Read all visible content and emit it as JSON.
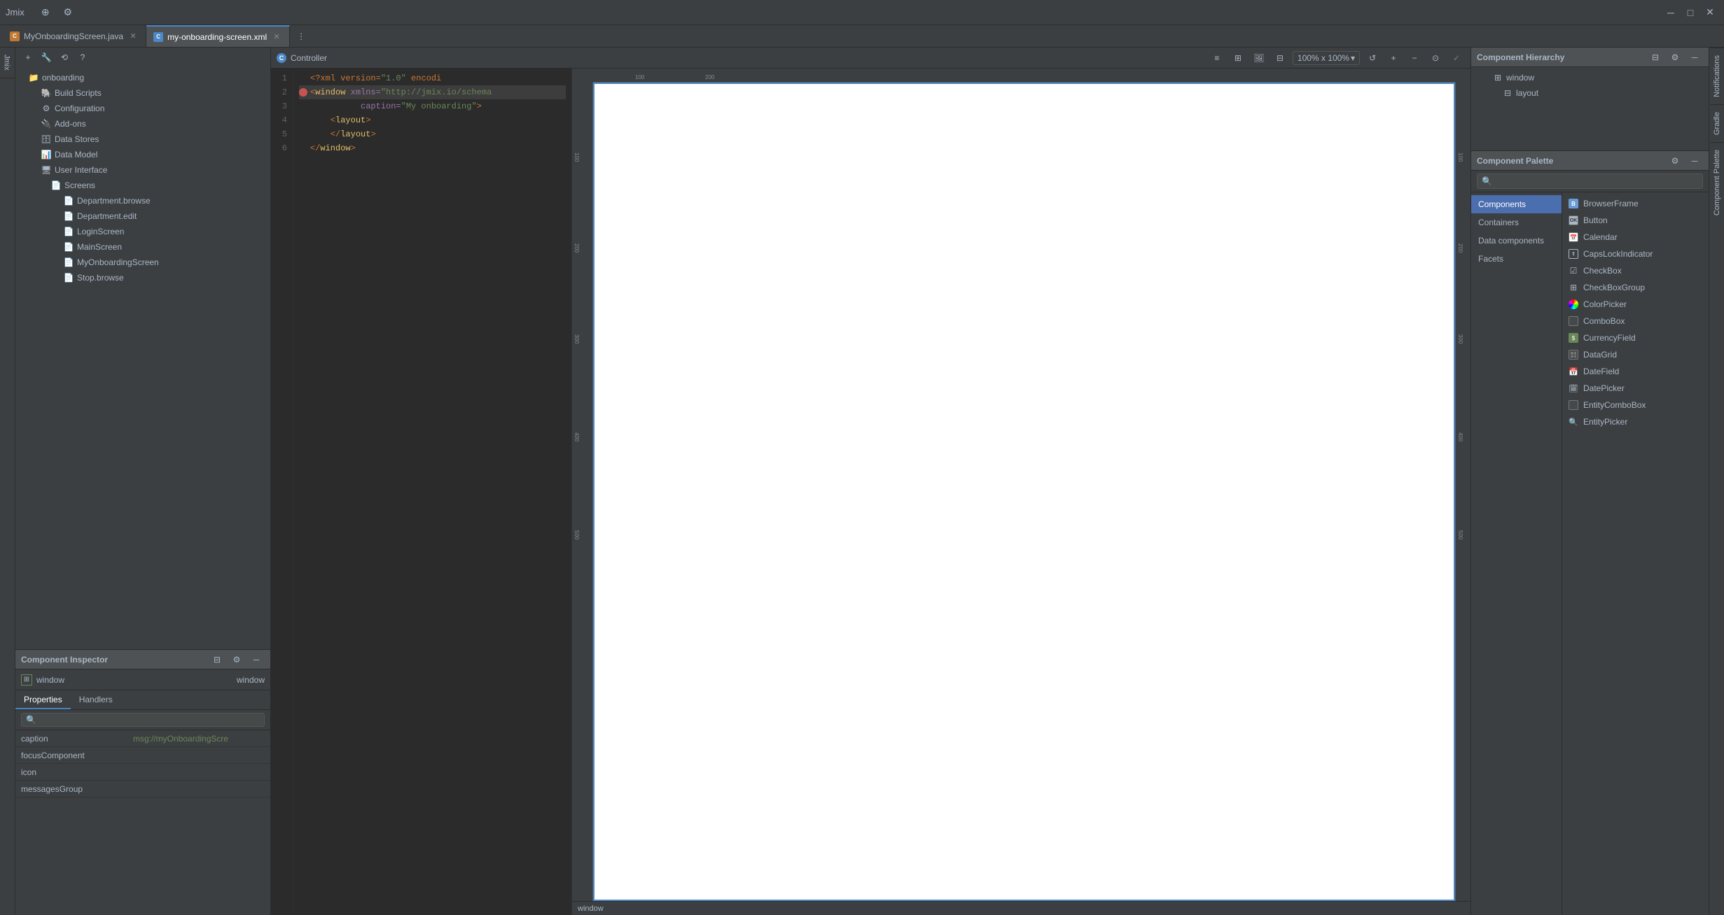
{
  "app": {
    "title": "Jmix",
    "window_controls": [
      "minimize",
      "maximize",
      "close"
    ]
  },
  "tabs": [
    {
      "id": "tab-java",
      "label": "MyOnboardingScreen.java",
      "type": "java",
      "active": false,
      "closable": true
    },
    {
      "id": "tab-xml",
      "label": "my-onboarding-screen.xml",
      "type": "xml",
      "active": true,
      "closable": true
    }
  ],
  "toolbar": {
    "controller_label": "Controller",
    "zoom_label": "100% x 100%",
    "buttons": [
      "list-view",
      "grid-view",
      "image-view",
      "table-view",
      "more"
    ]
  },
  "sidebar": {
    "root_item": "onboarding",
    "items": [
      {
        "label": "Build Scripts",
        "icon": "gradle",
        "depth": 1
      },
      {
        "label": "Configuration",
        "icon": "config",
        "depth": 1
      },
      {
        "label": "Add-ons",
        "icon": "addon",
        "depth": 1
      },
      {
        "label": "Data Stores",
        "icon": "datastore",
        "depth": 1
      },
      {
        "label": "Data Model",
        "icon": "datamodel",
        "depth": 1
      },
      {
        "label": "User Interface",
        "icon": "ui",
        "depth": 1,
        "expanded": true
      },
      {
        "label": "Screens",
        "icon": "screens",
        "depth": 2,
        "expanded": true
      },
      {
        "label": "Department.browse",
        "icon": "file",
        "depth": 3
      },
      {
        "label": "Department.edit",
        "icon": "file",
        "depth": 3
      },
      {
        "label": "LoginScreen",
        "icon": "file",
        "depth": 3
      },
      {
        "label": "MainScreen",
        "icon": "file",
        "depth": 3
      },
      {
        "label": "MyOnboardingScreen",
        "icon": "file",
        "depth": 3
      },
      {
        "label": "Stop.browse",
        "icon": "file",
        "depth": 3
      }
    ]
  },
  "code_editor": {
    "lines": [
      {
        "num": 1,
        "content": "<?xml version=\"1.0\" encodi",
        "type": "normal",
        "indent": 0
      },
      {
        "num": 2,
        "content": "  <window xmlns=\"http://jmix.io/schema",
        "type": "highlighted",
        "breakpoint": true,
        "indent": 0
      },
      {
        "num": 3,
        "content": "          caption=\"My onboarding\">",
        "type": "normal",
        "indent": 0
      },
      {
        "num": 4,
        "content": "    <layout>",
        "type": "normal",
        "indent": 1
      },
      {
        "num": 5,
        "content": "    </layout>",
        "type": "normal",
        "indent": 1
      },
      {
        "num": 6,
        "content": "</window>",
        "type": "normal",
        "indent": 0
      }
    ]
  },
  "component_hierarchy": {
    "title": "Component Hierarchy",
    "items": [
      {
        "label": "window",
        "depth": 0,
        "icon": "window"
      },
      {
        "label": "layout",
        "depth": 1,
        "icon": "layout"
      }
    ]
  },
  "component_palette": {
    "title": "Component Palette",
    "search_placeholder": "🔍",
    "categories": [
      {
        "label": "Components",
        "active": true
      },
      {
        "label": "Containers",
        "active": false
      },
      {
        "label": "Data components",
        "active": false
      },
      {
        "label": "Facets",
        "active": false
      }
    ],
    "components": [
      {
        "label": "BrowserFrame",
        "icon": "browser"
      },
      {
        "label": "Button",
        "icon": "button"
      },
      {
        "label": "Calendar",
        "icon": "calendar"
      },
      {
        "label": "CapsLockIndicator",
        "icon": "caps"
      },
      {
        "label": "CheckBox",
        "icon": "checkbox"
      },
      {
        "label": "CheckBoxGroup",
        "icon": "checkboxgroup"
      },
      {
        "label": "ColorPicker",
        "icon": "colorpicker"
      },
      {
        "label": "ComboBox",
        "icon": "combobox"
      },
      {
        "label": "CurrencyField",
        "icon": "currency"
      },
      {
        "label": "DataGrid",
        "icon": "datagrid"
      },
      {
        "label": "DateField",
        "icon": "datefield"
      },
      {
        "label": "DatePicker",
        "icon": "datepicker"
      },
      {
        "label": "EntityComboBox",
        "icon": "entitycombo"
      },
      {
        "label": "EntityPicker",
        "icon": "entitypicker"
      }
    ]
  },
  "inspector": {
    "title": "Component Inspector",
    "component_name": "window",
    "component_type": "window",
    "tabs": [
      "Properties",
      "Handlers"
    ],
    "active_tab": "Properties",
    "search_placeholder": "🔍",
    "properties": [
      {
        "name": "caption",
        "value": "msg://myOnboardingScre"
      },
      {
        "name": "focusComponent",
        "value": ""
      },
      {
        "name": "icon",
        "value": ""
      },
      {
        "name": "messagesGroup",
        "value": ""
      }
    ]
  },
  "side_strips": {
    "right": [
      "Notifications",
      "Gradle"
    ],
    "left": [
      "Jmix",
      "Component Palette"
    ]
  },
  "status_bar": {
    "text": "window"
  }
}
